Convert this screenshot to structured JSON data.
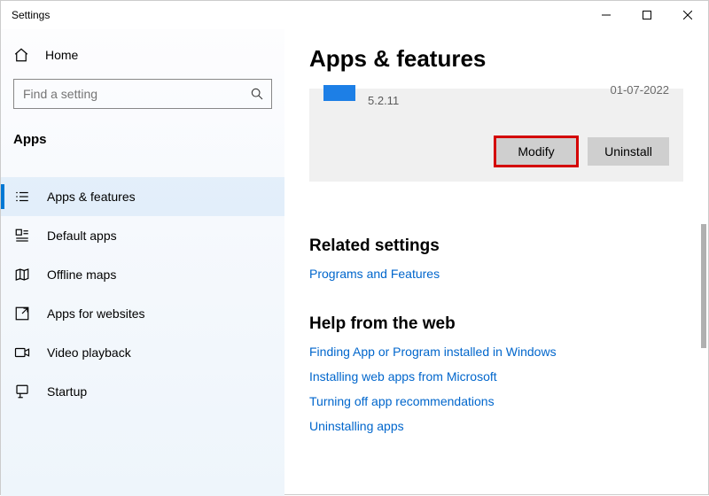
{
  "window": {
    "title": "Settings"
  },
  "sidebar": {
    "home": "Home",
    "search_placeholder": "Find a setting",
    "section": "Apps",
    "items": [
      {
        "label": "Apps & features",
        "active": true
      },
      {
        "label": "Default apps"
      },
      {
        "label": "Offline maps"
      },
      {
        "label": "Apps for websites"
      },
      {
        "label": "Video playback"
      },
      {
        "label": "Startup"
      }
    ]
  },
  "page": {
    "title": "Apps & features",
    "app": {
      "version": "5.2.11",
      "date": "01-07-2022",
      "modify": "Modify",
      "uninstall": "Uninstall"
    },
    "related": {
      "heading": "Related settings",
      "links": [
        "Programs and Features"
      ]
    },
    "help": {
      "heading": "Help from the web",
      "links": [
        "Finding App or Program installed in Windows",
        "Installing web apps from Microsoft",
        "Turning off app recommendations",
        "Uninstalling apps"
      ]
    }
  }
}
